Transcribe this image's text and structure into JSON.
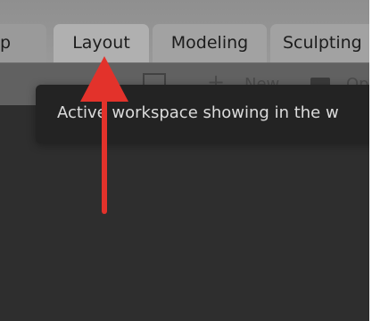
{
  "tabs": {
    "partial": "p",
    "layout": "Layout",
    "modeling": "Modeling",
    "sculpting": "Sculpting"
  },
  "toolbar": {
    "plus": "+",
    "new_label": "New",
    "open_label": "Op"
  },
  "tooltip": {
    "text": "Active workspace showing in the w"
  },
  "colors": {
    "viewport": "#2e2e2e",
    "topbar": "#949494",
    "active_tab": "#b0b0b0",
    "tooltip_bg": "#232323",
    "arrow": "#e3322b"
  },
  "icons": [
    "editor-type-icon",
    "plus-icon",
    "folder-icon",
    "annotation-arrow"
  ]
}
